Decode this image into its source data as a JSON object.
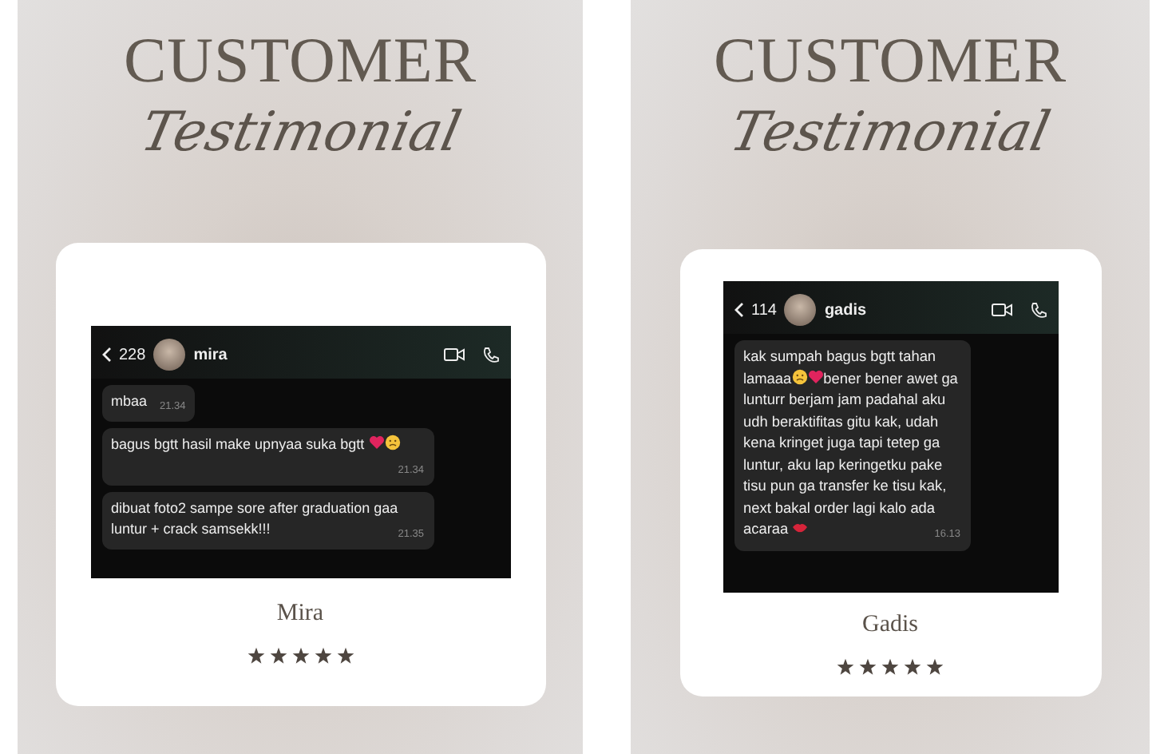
{
  "panels": [
    {
      "title": "CUSTOMER",
      "subtitle": "Testimonial",
      "chat": {
        "count": "228",
        "contact": "mira",
        "messages": [
          {
            "parts": [
              {
                "kind": "text",
                "text": "mbaa"
              }
            ],
            "time": "21.34"
          },
          {
            "parts": [
              {
                "kind": "text",
                "text": "bagus bgtt hasil make upnyaa suka bgtt "
              },
              {
                "kind": "heart"
              },
              {
                "kind": "face"
              }
            ],
            "time": "21.34"
          },
          {
            "parts": [
              {
                "kind": "text",
                "text": "dibuat foto2 sampe sore after graduation gaa luntur + crack samsekk!!!"
              }
            ],
            "time": "21.35"
          }
        ]
      },
      "name": "Mira",
      "stars": 5
    },
    {
      "title": "CUSTOMER",
      "subtitle": "Testimonial",
      "chat": {
        "count": "114",
        "contact": "gadis",
        "messages": [
          {
            "parts": [
              {
                "kind": "text",
                "text": "kak sumpah bagus bgtt tahan lamaaa"
              },
              {
                "kind": "face"
              },
              {
                "kind": "heart"
              },
              {
                "kind": "text",
                "text": "bener bener awet ga lunturr berjam jam padahal aku udh beraktifitas gitu kak, udah kena kringet juga tapi tetep ga luntur, aku lap keringetku pake tisu pun ga transfer ke tisu kak, next bakal order lagi kalo ada acaraa "
              },
              {
                "kind": "lips"
              }
            ],
            "time": "16.13"
          }
        ]
      },
      "name": "Gadis",
      "stars": 5
    }
  ]
}
